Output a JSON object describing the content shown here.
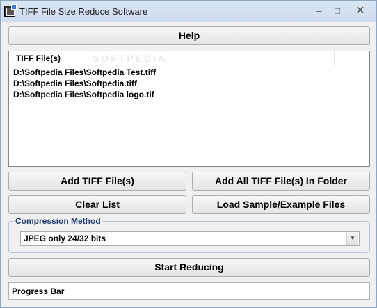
{
  "window": {
    "title": "TIFF File Size Reduce Software",
    "minimize_glyph": "–",
    "maximize_glyph": "□",
    "close_glyph": "✕"
  },
  "toolbar": {
    "help_label": "Help",
    "add_files_label": "Add TIFF File(s)",
    "add_folder_label": "Add All TIFF File(s) In Folder",
    "clear_label": "Clear List",
    "load_sample_label": "Load Sample/Example Files",
    "start_label": "Start Reducing"
  },
  "file_list": {
    "column_header": "TIFF File(s)",
    "watermark": "SOFTPEDIA",
    "rows": [
      "D:\\Softpedia Files\\Softpedia Test.tiff",
      "D:\\Softpedia Files\\Softpedia.tiff",
      "D:\\Softpedia Files\\Softpedia logo.tif"
    ]
  },
  "compression": {
    "group_label": "Compression Method",
    "selected": "JPEG only 24/32 bits",
    "arrow_glyph": "▼"
  },
  "progress": {
    "label": "Progress Bar"
  },
  "icons": {
    "app": "tiff-app-icon",
    "dropdown": "chevron-down-icon"
  }
}
